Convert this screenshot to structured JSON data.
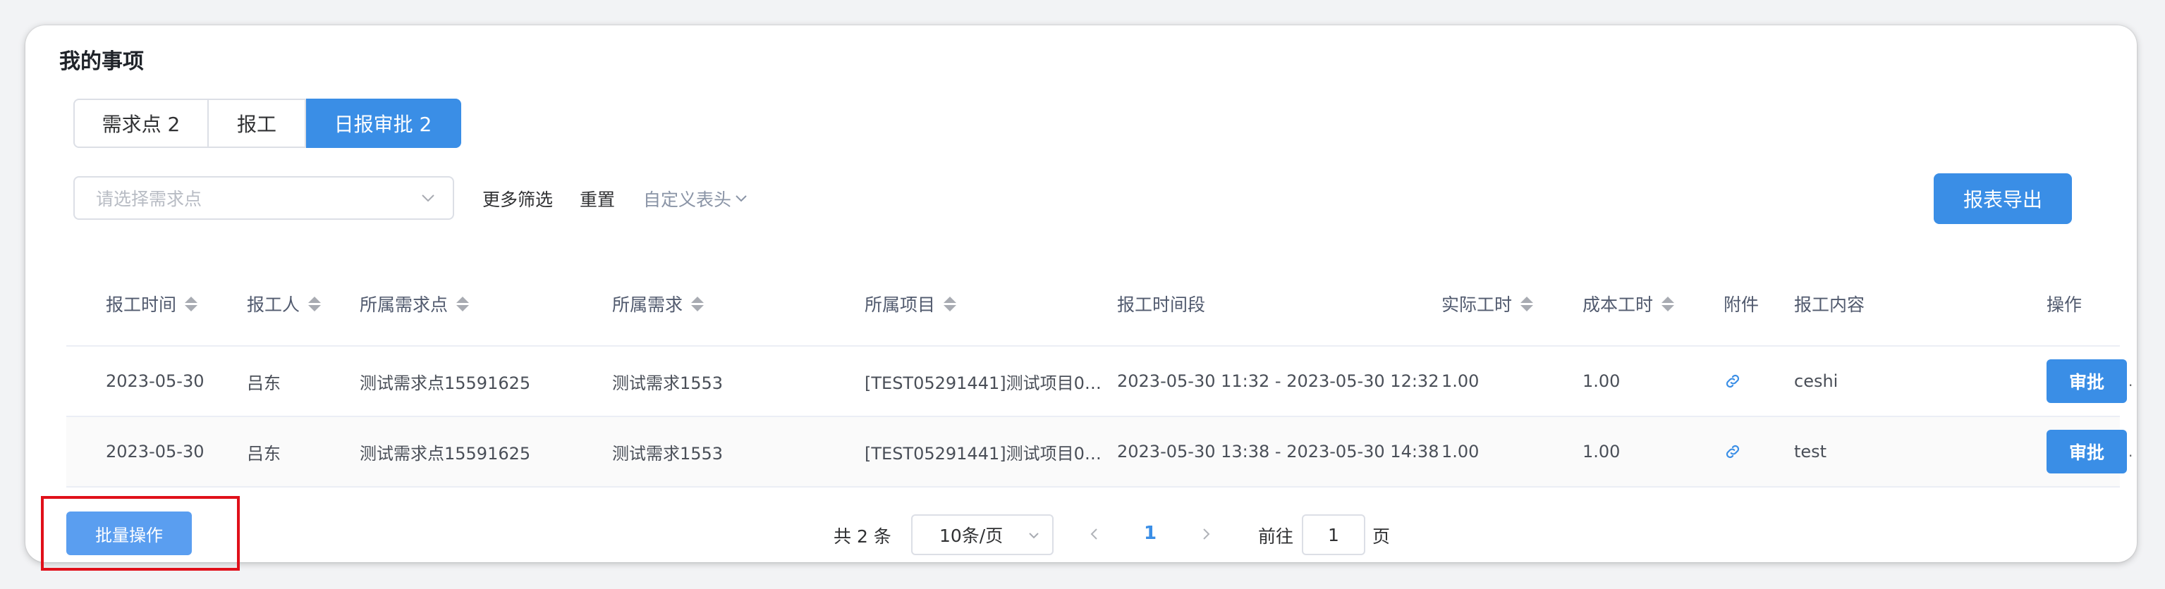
{
  "page": {
    "title": "我的事项"
  },
  "tabs": [
    {
      "label": "需求点 2",
      "active": false
    },
    {
      "label": "报工",
      "active": false
    },
    {
      "label": "日报审批 2",
      "active": true
    }
  ],
  "filters": {
    "select_placeholder": "请选择需求点",
    "more_label": "更多筛选",
    "reset_label": "重置",
    "custom_header_label": "自定义表头"
  },
  "export_label": "报表导出",
  "table": {
    "columns": [
      "报工时间",
      "报工人",
      "所属需求点",
      "所属需求",
      "所属项目",
      "报工时间段",
      "实际工时",
      "成本工时",
      "附件",
      "报工内容",
      "操作"
    ],
    "rows": [
      {
        "date": "2023-05-30",
        "person": "吕东",
        "point": "测试需求点15591625",
        "demand": "测试需求1553",
        "project": "[TEST05291441]测试项目0…",
        "period": "2023-05-30 11:32 - 2023-05-30 12:32",
        "actual": "1.00",
        "cost": "1.00",
        "content": "ceshi",
        "action": "审批"
      },
      {
        "date": "2023-05-30",
        "person": "吕东",
        "point": "测试需求点15591625",
        "demand": "测试需求1553",
        "project": "[TEST05291441]测试项目0…",
        "period": "2023-05-30 13:38 - 2023-05-30 14:38",
        "actual": "1.00",
        "cost": "1.00",
        "content": "test",
        "action": "审批"
      }
    ],
    "row_overflow_mark": "."
  },
  "batch_label": "批量操作",
  "pagination": {
    "total": "共 2 条",
    "page_size": "10条/页",
    "current_page": "1",
    "goto_label": "前往",
    "goto_value": "1",
    "page_suffix": "页"
  },
  "colors": {
    "primary": "#3a8ee6",
    "highlight": "#e0101a"
  }
}
